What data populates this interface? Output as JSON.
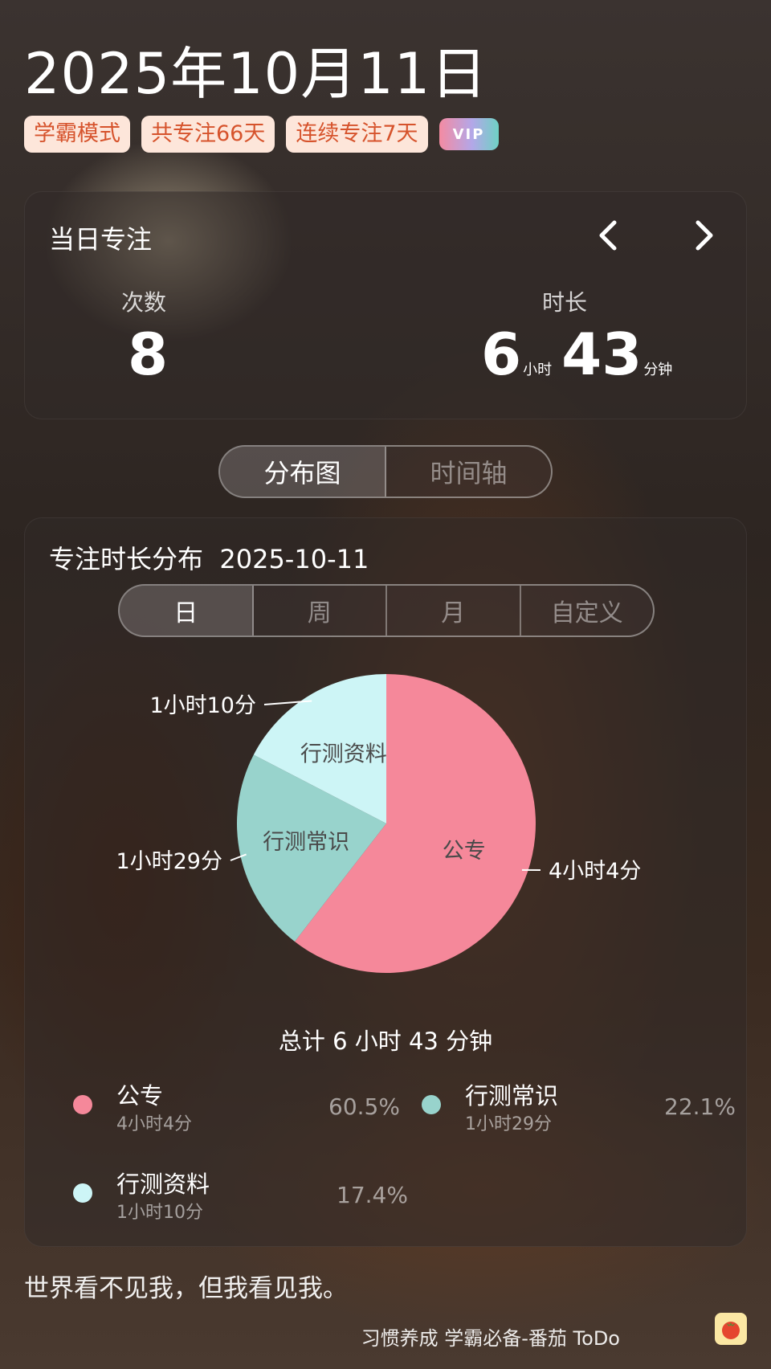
{
  "header": {
    "date": "2025年10月11日",
    "badges": [
      "学霸模式",
      "共专注66天",
      "连续专注7天"
    ],
    "vip_label": "VIP"
  },
  "daily_focus": {
    "title": "当日专注",
    "count_label": "次数",
    "count_value": "8",
    "duration_label": "时长",
    "duration_hours": "6",
    "hours_unit": "小时",
    "duration_minutes": "43",
    "minutes_unit": "分钟"
  },
  "view_tabs": [
    "分布图",
    "时间轴"
  ],
  "active_view_tab": 0,
  "distribution": {
    "title": "专注时长分布",
    "date": "2025-10-11",
    "period_tabs": [
      "日",
      "周",
      "月",
      "自定义"
    ],
    "active_period_tab": 0,
    "total_text": "总计 6 小时 43 分钟"
  },
  "chart_data": {
    "type": "pie",
    "slices": [
      {
        "name": "公专",
        "duration": "4小时4分",
        "percent": 60.5,
        "percent_label": "60.5%",
        "color": "#f5889a"
      },
      {
        "name": "行测常识",
        "duration": "1小时29分",
        "percent": 22.1,
        "percent_label": "22.1%",
        "color": "#98d3cc"
      },
      {
        "name": "行测资料",
        "duration": "1小时10分",
        "percent": 17.4,
        "percent_label": "17.4%",
        "color": "#cdf5f6"
      }
    ]
  },
  "quote": "世界看不见我，但我看见我。",
  "footer": {
    "text": "习惯养成 学霸必备-番茄 ToDo"
  }
}
